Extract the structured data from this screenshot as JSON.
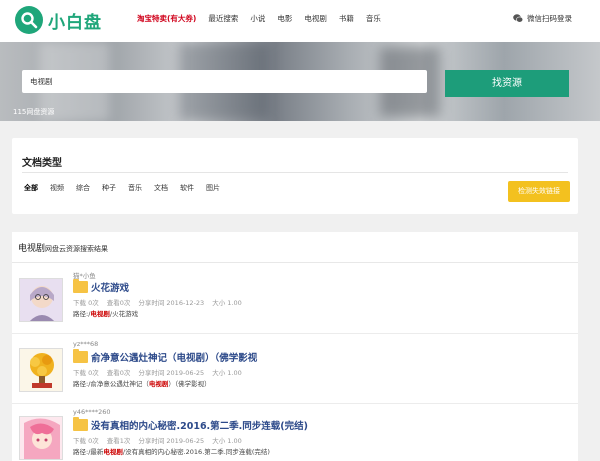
{
  "header": {
    "logo_text": "小白盘",
    "nav": [
      "淘宝特卖(有大券)",
      "最近搜索",
      "小说",
      "电影",
      "电视剧",
      "书籍",
      "音乐"
    ],
    "login": "微信扫码登录"
  },
  "search": {
    "value": "电视剧",
    "button": "找资源",
    "count_text": "115网盘资源"
  },
  "types": {
    "title": "文档类型",
    "items": [
      "全部",
      "视频",
      "综合",
      "种子",
      "音乐",
      "文档",
      "软件",
      "图片"
    ],
    "detect_button": "检测失效链接"
  },
  "results": {
    "keyword": "电视剧",
    "heading_suffix": "网盘云资源搜索结果",
    "items": [
      {
        "uploader": "猫*小鱼",
        "title": "火花游戏",
        "downloads": "下载 0次",
        "views": "查看0次",
        "share_time": "分享时间 2016-12-23",
        "size": "大小 1.00",
        "path_prefix": "路径:/",
        "path_keyword": "电视剧",
        "path_rest": "/火花游戏"
      },
      {
        "uploader": "yz***68",
        "title": "俞净意公遇灶神记（电视剧）（佛学影视",
        "downloads": "下载 0次",
        "views": "查看0次",
        "share_time": "分享时间 2019-06-25",
        "size": "大小 1.00",
        "path_prefix": "路径:/俞净意公遇灶神记（",
        "path_keyword": "电视剧",
        "path_rest": "）（佛学影视）"
      },
      {
        "uploader": "y46****260",
        "title": "没有真相的内心秘密.2016.第二季.同步连载(完结)",
        "downloads": "下载 0次",
        "views": "查看1次",
        "share_time": "分享时间 2019-06-25",
        "size": "大小 1.00",
        "path_prefix": "路径:/最新",
        "path_keyword": "电视剧",
        "path_rest": "/没有真相的内心秘密.2016.第二季.同步连载(完结)"
      }
    ]
  },
  "colors": {
    "brand": "#1fa67a",
    "button": "#1d9d7a",
    "detect": "#f3c11f",
    "title": "#2d4a8a",
    "highlight": "#cc0000"
  }
}
